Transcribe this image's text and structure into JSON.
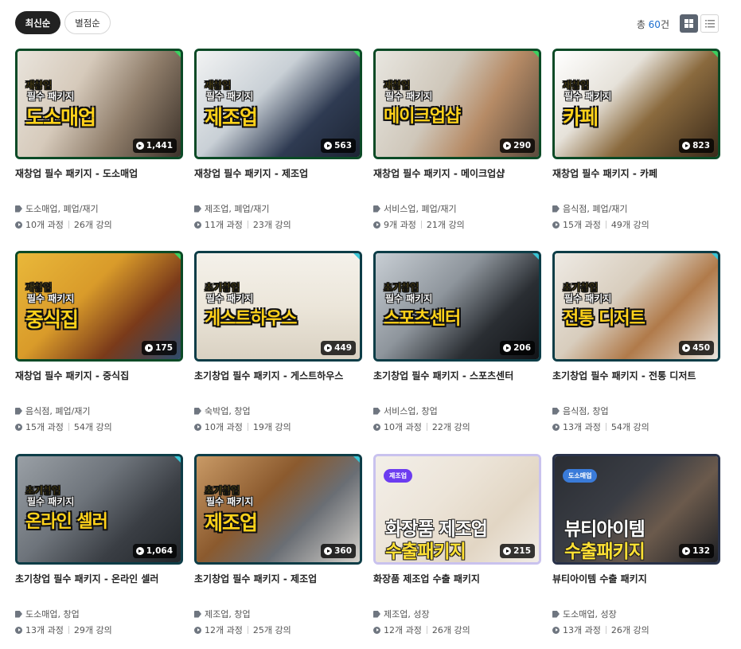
{
  "toolbar": {
    "sort_latest": "최신순",
    "sort_rating": "별점순",
    "total_prefix": "총 ",
    "total_count": "60",
    "total_suffix": "건"
  },
  "cards": [
    {
      "thumb_line1": "재창업",
      "thumb_line2": "필수 패키지",
      "thumb_big": "도소매업",
      "views": "1,441",
      "title": "재창업 필수 패키지 - 도소매업",
      "tags": "도소매업, 폐업/재기",
      "courses": "10개 과정",
      "lectures": "26개 강의"
    },
    {
      "thumb_line1": "재창업",
      "thumb_line2": "필수 패키지",
      "thumb_big": "제조업",
      "views": "563",
      "title": "재창업 필수 패키지 - 제조업",
      "tags": "제조업, 폐업/재기",
      "courses": "11개 과정",
      "lectures": "23개 강의"
    },
    {
      "thumb_line1": "재창업",
      "thumb_line2": "필수 패키지",
      "thumb_big": "메이크업샵",
      "views": "290",
      "title": "재창업 필수 패키지 - 메이크업샵",
      "tags": "서비스업, 폐업/재기",
      "courses": "9개 과정",
      "lectures": "21개 강의"
    },
    {
      "thumb_line1": "재창업",
      "thumb_line2": "필수 패키지",
      "thumb_big": "카페",
      "views": "823",
      "title": "재창업 필수 패키지 - 카페",
      "tags": "음식점, 폐업/재기",
      "courses": "15개 과정",
      "lectures": "49개 강의"
    },
    {
      "thumb_line1": "재창업",
      "thumb_line2": "필수 패키지",
      "thumb_big": "중식집",
      "views": "175",
      "title": "재창업 필수 패키지 - 중식집",
      "tags": "음식점, 폐업/재기",
      "courses": "15개 과정",
      "lectures": "54개 강의"
    },
    {
      "thumb_line1": "초기창업",
      "thumb_line2": "필수 패키지",
      "thumb_big": "게스트하우스",
      "views": "449",
      "title": "초기창업 필수 패키지 - 게스트하우스",
      "tags": "숙박업, 창업",
      "courses": "10개 과정",
      "lectures": "19개 강의"
    },
    {
      "thumb_line1": "초기창업",
      "thumb_line2": "필수 패키지",
      "thumb_big": "스포츠센터",
      "views": "206",
      "title": "초기창업 필수 패키지 - 스포츠센터",
      "tags": "서비스업, 창업",
      "courses": "10개 과정",
      "lectures": "22개 강의"
    },
    {
      "thumb_line1": "초기창업",
      "thumb_line2": "필수 패키지",
      "thumb_big": "전통 디저트",
      "views": "450",
      "title": "초기창업 필수 패키지 - 전통 디저트",
      "tags": "음식점, 창업",
      "courses": "13개 과정",
      "lectures": "54개 강의"
    },
    {
      "thumb_line1": "초기창업",
      "thumb_line2": "필수 패키지",
      "thumb_big": "온라인 셀러",
      "views": "1,064",
      "title": "초기창업 필수 패키지 - 온라인 셀러",
      "tags": "도소매업, 창업",
      "courses": "13개 과정",
      "lectures": "29개 강의"
    },
    {
      "thumb_line1": "초기창업",
      "thumb_line2": "필수 패키지",
      "thumb_big": "제조업",
      "views": "360",
      "title": "초기창업 필수 패키지 - 제조업",
      "tags": "제조업, 창업",
      "courses": "12개 과정",
      "lectures": "25개 강의"
    },
    {
      "thumb_tag": "제조업",
      "thumb_big_a": "화장품 제조업",
      "thumb_big_b": "수출패키지",
      "views": "215",
      "title": "화장품 제조업 수출 패키지",
      "tags": "제조업, 성장",
      "courses": "12개 과정",
      "lectures": "26개 강의"
    },
    {
      "thumb_tag": "도소매업",
      "thumb_big_a": "뷰티아이템",
      "thumb_big_b": "수출패키지",
      "views": "132",
      "title": "뷰티아이템 수출 패키지",
      "tags": "도소매업, 성장",
      "courses": "13개 과정",
      "lectures": "26개 강의"
    }
  ]
}
